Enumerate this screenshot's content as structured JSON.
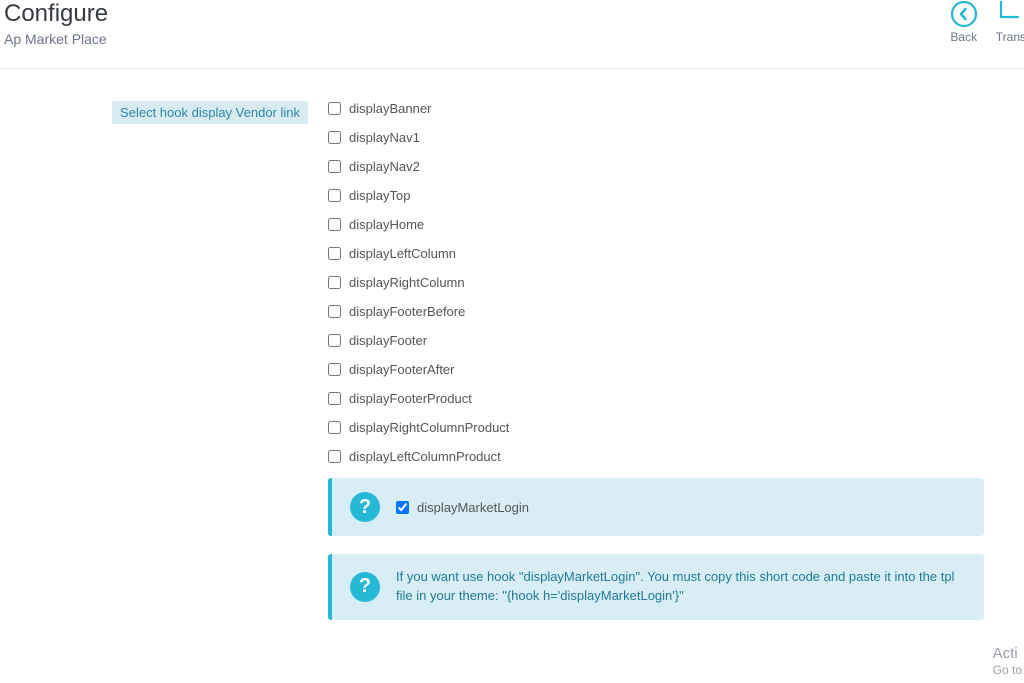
{
  "header": {
    "title": "Configure",
    "subtitle": "Ap Market Place",
    "actions": {
      "back": "Back",
      "translate": "Trans"
    }
  },
  "form": {
    "label": "Select hook display Vendor link",
    "options": [
      {
        "label": "displayBanner",
        "checked": false
      },
      {
        "label": "displayNav1",
        "checked": false
      },
      {
        "label": "displayNav2",
        "checked": false
      },
      {
        "label": "displayTop",
        "checked": false
      },
      {
        "label": "displayHome",
        "checked": false
      },
      {
        "label": "displayLeftColumn",
        "checked": false
      },
      {
        "label": "displayRightColumn",
        "checked": false
      },
      {
        "label": "displayFooterBefore",
        "checked": false
      },
      {
        "label": "displayFooter",
        "checked": false
      },
      {
        "label": "displayFooterAfter",
        "checked": false
      },
      {
        "label": "displayFooterProduct",
        "checked": false
      },
      {
        "label": "displayRightColumnProduct",
        "checked": false
      },
      {
        "label": "displayLeftColumnProduct",
        "checked": false
      }
    ],
    "highlight_option": {
      "label": "displayMarketLogin",
      "checked": true
    },
    "hint_text": "If you want use hook \"displayMarketLogin\". You must copy this short code and paste it into the tpl file in your theme: \"{hook h='displayMarketLogin'}\""
  },
  "watermark": {
    "line1": "Acti",
    "line2": "Go to"
  }
}
